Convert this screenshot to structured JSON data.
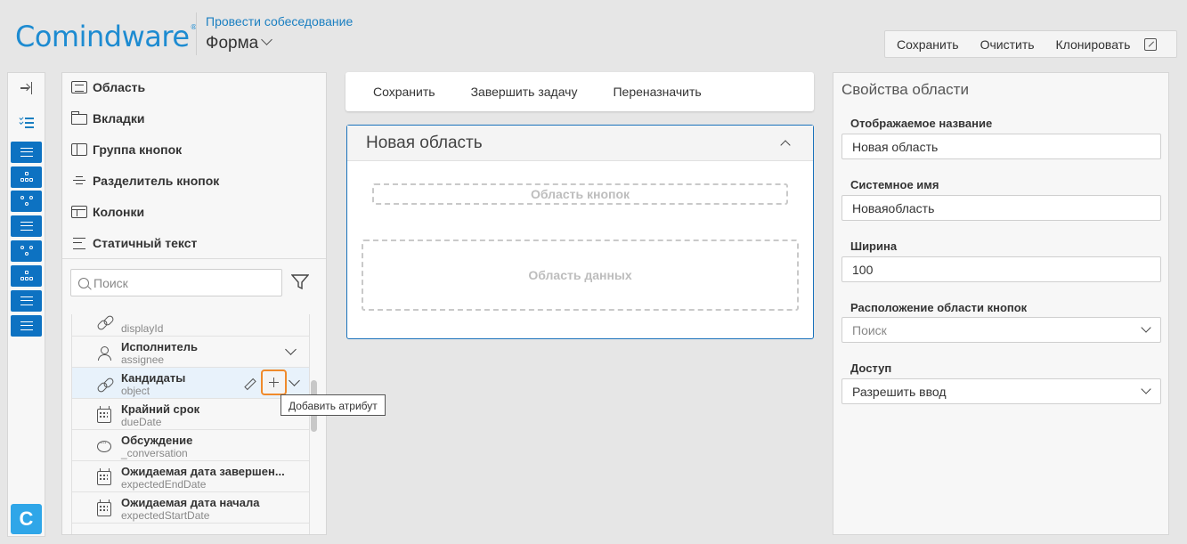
{
  "header": {
    "logo": "Comindware",
    "process_link": "Провести собеседование",
    "form_title": "Форма",
    "actions": [
      "Сохранить",
      "Очистить",
      "Клонировать"
    ]
  },
  "rail": {
    "buttons": [
      "lines",
      "tree",
      "flow",
      "lines",
      "flow",
      "tree",
      "lines",
      "lines"
    ],
    "logo_letter": "C"
  },
  "palette": {
    "items": [
      {
        "label": "Область",
        "icon": "area-icon"
      },
      {
        "label": "Вкладки",
        "icon": "tabs-icon"
      },
      {
        "label": "Группа кнопок",
        "icon": "button-group-icon"
      },
      {
        "label": "Разделитель кнопок",
        "icon": "button-separator-icon"
      },
      {
        "label": "Колонки",
        "icon": "columns-icon"
      },
      {
        "label": "Статичный текст",
        "icon": "static-text-icon"
      }
    ],
    "search_placeholder": "Поиск",
    "attributes": [
      {
        "name": "",
        "system": "displayId",
        "icon": "link-icon"
      },
      {
        "name": "Исполнитель",
        "system": "assignee",
        "icon": "user-icon"
      },
      {
        "name": "Кандидаты",
        "system": "object",
        "icon": "link-icon"
      },
      {
        "name": "Крайний срок",
        "system": "dueDate",
        "icon": "calendar-icon"
      },
      {
        "name": "Обсуждение",
        "system": "_conversation",
        "icon": "chat-icon"
      },
      {
        "name": "Ожидаемая дата завершен...",
        "system": "expectedEndDate",
        "icon": "calendar-icon"
      },
      {
        "name": "Ожидаемая дата начала",
        "system": "expectedStartDate",
        "icon": "calendar-icon"
      }
    ],
    "tooltip": "Добавить атрибут"
  },
  "toolbar": {
    "buttons": [
      "Сохранить",
      "Завершить задачу",
      "Переназначить"
    ]
  },
  "area": {
    "title": "Новая область",
    "button_zone": "Область кнопок",
    "data_zone": "Область данных"
  },
  "props": {
    "title": "Свойства области",
    "display_name_label": "Отображаемое название",
    "display_name_value": "Новая область",
    "system_name_label": "Системное имя",
    "system_name_value": "Новаяобласть",
    "width_label": "Ширина",
    "width_value": "100",
    "button_area_label": "Расположение области кнопок",
    "button_area_placeholder": "Поиск",
    "access_label": "Доступ",
    "access_value": "Разрешить ввод"
  },
  "colors": {
    "accent": "#0d72c2",
    "link": "#1a7fc1",
    "highlight": "#f08a2b"
  }
}
